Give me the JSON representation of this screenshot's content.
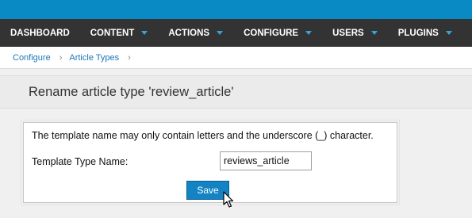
{
  "menu": {
    "items": [
      {
        "label": "DASHBOARD"
      },
      {
        "label": "CONTENT"
      },
      {
        "label": "ACTIONS"
      },
      {
        "label": "CONFIGURE"
      },
      {
        "label": "USERS"
      },
      {
        "label": "PLUGINS"
      }
    ]
  },
  "breadcrumb": {
    "items": [
      {
        "label": "Configure"
      },
      {
        "label": "Article Types"
      }
    ],
    "separator": "›"
  },
  "page": {
    "title": "Rename article type 'review_article'"
  },
  "form": {
    "note": "The template name may only contain letters and the underscore (_) character.",
    "field_label": "Template Type Name:",
    "field_value": "reviews_article",
    "save_label": "Save"
  },
  "colors": {
    "top_strip": "#0a8ac4",
    "menubar": "#333333",
    "menu_caret": "#36a3dd",
    "link": "#1a78b5",
    "button": "#1383c4"
  },
  "icons": {
    "menu_caret": "chevron-down-icon",
    "breadcrumb_separator": "chevron-right-icon",
    "cursor": "mouse-pointer-icon"
  }
}
